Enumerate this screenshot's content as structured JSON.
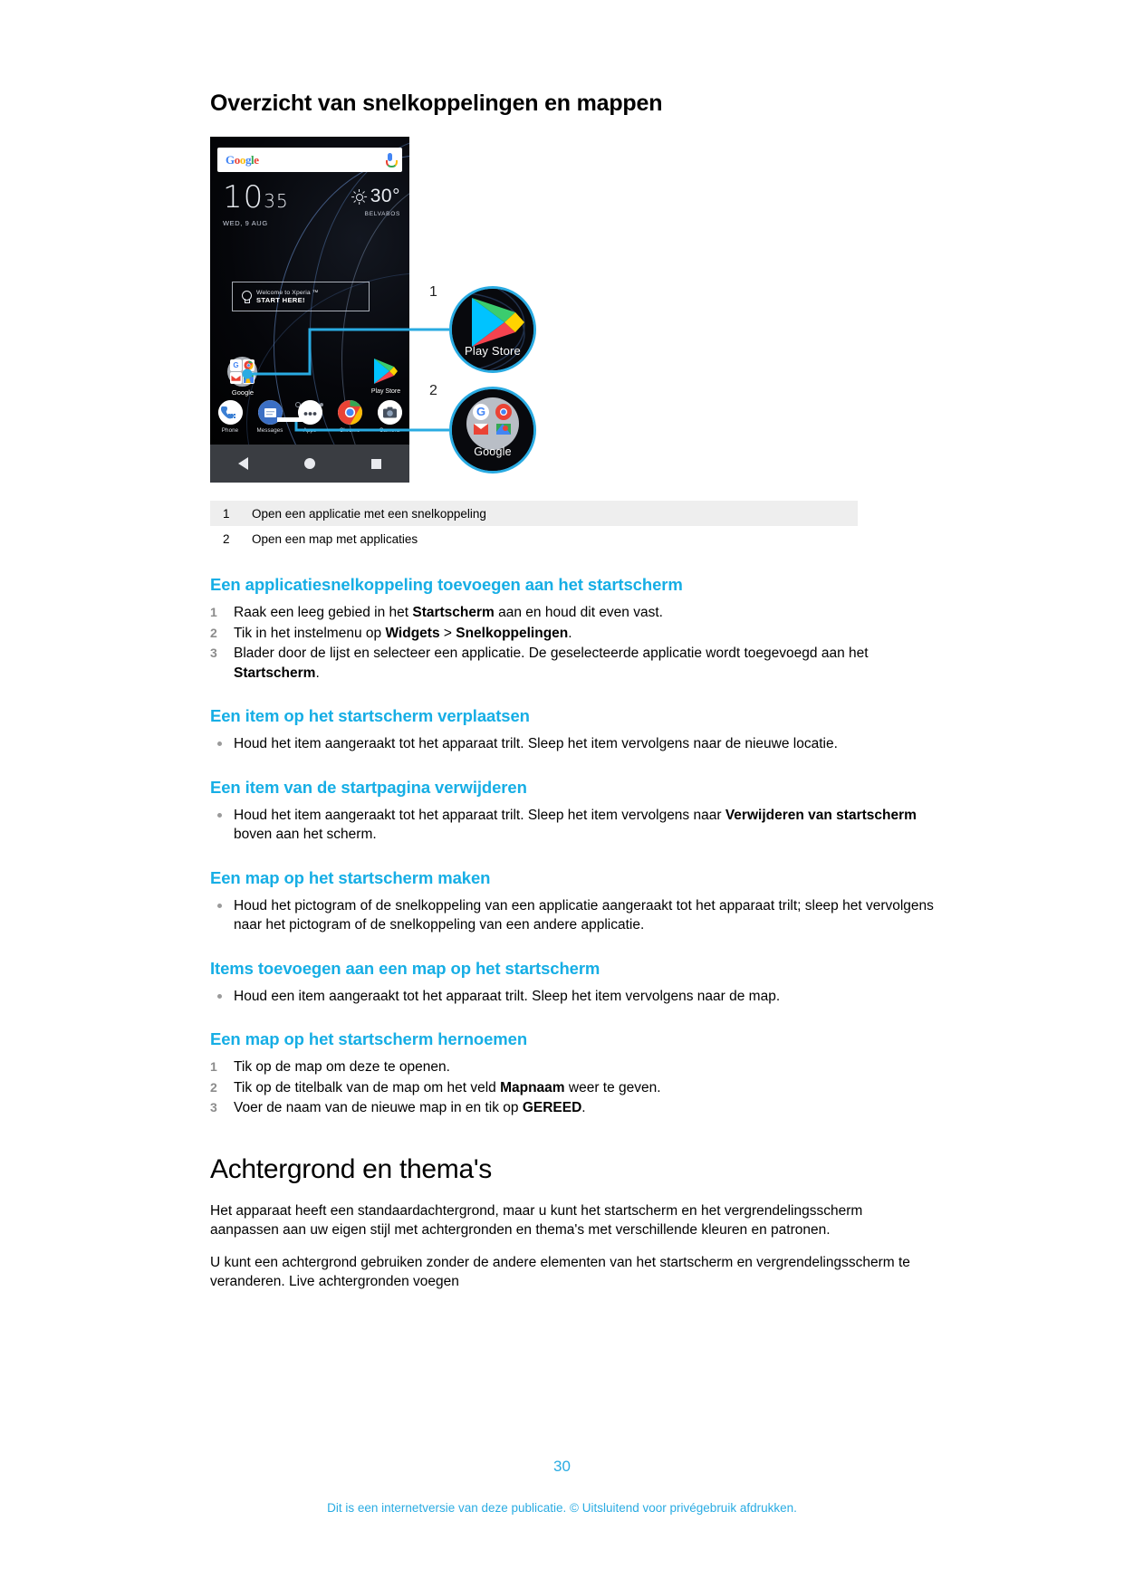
{
  "document": {
    "title": "Overzicht van snelkoppelingen en mappen",
    "page_number": "30",
    "footnote": "Dit is een internetversie van deze publicatie. © Uitsluitend voor privégebruik afdrukken.",
    "accent_color": "#29ABE2",
    "heading_color": "#16AEE5"
  },
  "figure": {
    "phone": {
      "search_logo": "Google",
      "search_logo_letters": [
        "G",
        "o",
        "o",
        "g",
        "l",
        "e"
      ],
      "mic_icon": "microphone-icon",
      "clock_hours": "10",
      "clock_minutes": "35",
      "date": "WED, 9 AUG",
      "weather_temp": "30°",
      "weather_location": "BELVABOS",
      "sun_icon": "sun-icon",
      "card_line1": "Welcome to Xperia ™",
      "card_line2": "START HERE!",
      "bulb_icon": "lightbulb-icon",
      "folder_label": "Google",
      "playstore_label": "Play Store",
      "dock": [
        {
          "label": "Phone",
          "icon": "phone-icon"
        },
        {
          "label": "Messages",
          "icon": "messages-icon"
        },
        {
          "label": "Apps",
          "icon": "apps-icon"
        },
        {
          "label": "Chrome",
          "icon": "chrome-icon"
        },
        {
          "label": "Camera",
          "icon": "camera-icon"
        }
      ],
      "navbar": [
        "back-icon",
        "home-icon",
        "recents-icon"
      ]
    },
    "callouts": [
      {
        "number": "1",
        "caption": "Play Store"
      },
      {
        "number": "2",
        "caption": "Google"
      }
    ]
  },
  "legend": {
    "rows": [
      {
        "num": "1",
        "text": "Open een applicatie met een snelkoppeling"
      },
      {
        "num": "2",
        "text": "Open een map met applicaties"
      }
    ]
  },
  "sections": [
    {
      "heading": "Een applicatiesnelkoppeling toevoegen aan het startscherm",
      "type": "ordered",
      "items": [
        {
          "num": "1",
          "html": "Raak een leeg gebied in het <b>Startscherm</b> aan en houd dit even vast."
        },
        {
          "num": "2",
          "html": "Tik in het instelmenu op <b>Widgets</b> &gt; <b>Snelkoppelingen</b>."
        },
        {
          "num": "3",
          "html": "Blader door de lijst en selecteer een applicatie. De geselecteerde applicatie wordt toegevoegd aan het <b>Startscherm</b>."
        }
      ]
    },
    {
      "heading": "Een item op het startscherm verplaatsen",
      "type": "bullet",
      "items": [
        {
          "html": "Houd het item aangeraakt tot het apparaat trilt. Sleep het item vervolgens naar de nieuwe locatie."
        }
      ]
    },
    {
      "heading": "Een item van de startpagina verwijderen",
      "type": "bullet",
      "items": [
        {
          "html": "Houd het item aangeraakt tot het apparaat trilt. Sleep het item vervolgens naar <b>Verwijderen van startscherm</b> boven aan het scherm."
        }
      ]
    },
    {
      "heading": "Een map op het startscherm maken",
      "type": "bullet",
      "items": [
        {
          "html": "Houd het pictogram of de snelkoppeling van een applicatie aangeraakt tot het apparaat trilt; sleep het vervolgens naar het pictogram of de snelkoppeling van een andere applicatie."
        }
      ]
    },
    {
      "heading": "Items toevoegen aan een map op het startscherm",
      "type": "bullet",
      "items": [
        {
          "html": "Houd een item aangeraakt tot het apparaat trilt. Sleep het item vervolgens naar de map."
        }
      ]
    },
    {
      "heading": "Een map op het startscherm hernoemen",
      "type": "ordered",
      "items": [
        {
          "num": "1",
          "html": "Tik op de map om deze te openen."
        },
        {
          "num": "2",
          "html": "Tik op de titelbalk van de map om het veld <b>Mapnaam</b> weer te geven."
        },
        {
          "num": "3",
          "html": "Voer de naam van de nieuwe map in en tik op <b>GEREED</b>."
        }
      ]
    }
  ],
  "chapter": {
    "title": "Achtergrond en thema's",
    "paragraphs": [
      "Het apparaat heeft een standaardachtergrond, maar u kunt het startscherm en het vergrendelingsscherm aanpassen aan uw eigen stijl met achtergronden en thema's met verschillende kleuren en patronen.",
      "U kunt een achtergrond gebruiken zonder de andere elementen van het startscherm en vergrendelingsscherm te veranderen. Live achtergronden voegen"
    ]
  }
}
